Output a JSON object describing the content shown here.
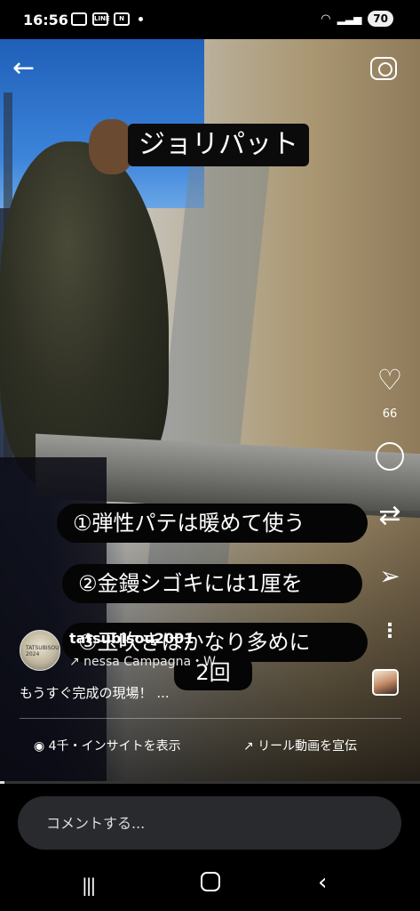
{
  "status_bar": {
    "time": "16:56",
    "battery": "70",
    "notif_icons": [
      "screenshot-icon",
      "line-icon",
      "news-icon"
    ]
  },
  "video": {
    "title_caption": "ジョリパット",
    "captions": [
      "①弾性パテは暖めて使う",
      "②金鏝シゴキには1厘を",
      "③玉吹きはかなり多めに",
      "2回"
    ]
  },
  "right_rail": {
    "likes": "66"
  },
  "author": {
    "name": "tatsubisou2001",
    "avatar_text": "TATSUBISOU 2024",
    "audio": "↗ nessa Campagna・W"
  },
  "post": {
    "caption": "もうすぐ完成の現場！ ..."
  },
  "actions": {
    "insights": "4千・インサイトを表示",
    "promote": "リール動画を宣伝"
  },
  "progress": 0.01,
  "comment": {
    "placeholder": "コメントする..."
  }
}
